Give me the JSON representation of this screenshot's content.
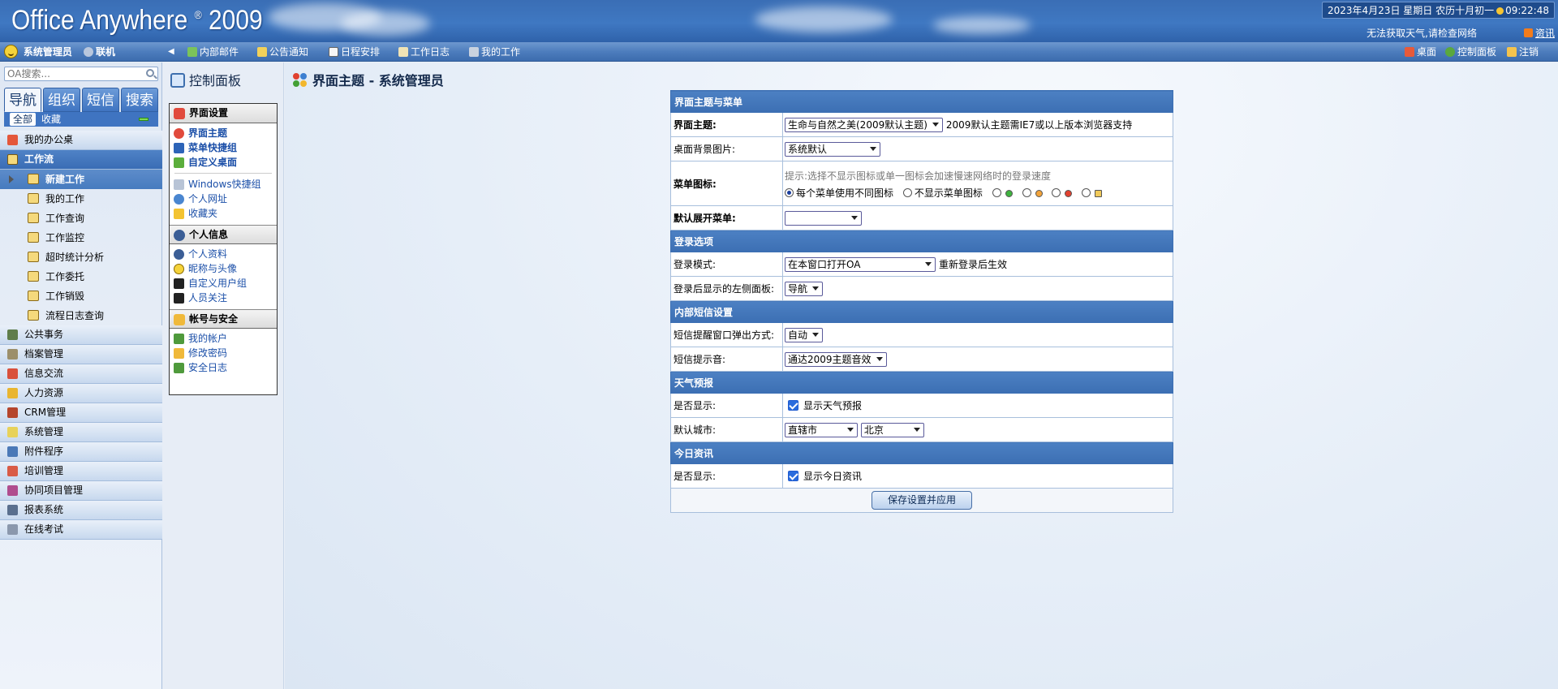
{
  "header": {
    "app_name": "Office Anywhere",
    "registered": "®",
    "version": "2009",
    "datetime": "2023年4月23日 星期日 农历十月初一",
    "time": "09:22:48",
    "weather": "无法获取天气,请检查网络",
    "news": "资讯"
  },
  "toolbar": {
    "user": "系统管理员",
    "status": "联机",
    "items": [
      "内部邮件",
      "公告通知",
      "日程安排",
      "工作日志",
      "我的工作"
    ],
    "desktop": "桌面",
    "control_panel": "控制面板",
    "logout": "注销"
  },
  "sidebar": {
    "search_placeholder": "OA搜索...",
    "tabs": [
      "导航",
      "组织",
      "短信",
      "搜索"
    ],
    "subtabs": [
      "全部",
      "收藏"
    ],
    "menu_top": "我的办公桌",
    "workflow": "工作流",
    "workflow_items": [
      "新建工作",
      "我的工作",
      "工作查询",
      "工作监控",
      "超时统计分析",
      "工作委托",
      "工作销毁",
      "流程日志查询"
    ],
    "menu_rest": [
      "公共事务",
      "档案管理",
      "信息交流",
      "人力资源",
      "CRM管理",
      "系统管理",
      "附件程序",
      "培训管理",
      "协同项目管理",
      "报表系统",
      "在线考试"
    ]
  },
  "panel": {
    "title": "控制面板",
    "sec1": "界面设置",
    "sec1_items": [
      "界面主题",
      "菜单快捷组",
      "自定义桌面"
    ],
    "sec1_extra": [
      "Windows快捷组",
      "个人网址",
      "收藏夹"
    ],
    "sec2": "个人信息",
    "sec2_items": [
      "个人资料",
      "昵称与头像",
      "自定义用户组",
      "人员关注"
    ],
    "sec3": "帐号与安全",
    "sec3_items": [
      "我的帐户",
      "修改密码",
      "安全日志"
    ]
  },
  "main": {
    "title": "界面主题 - 系统管理员",
    "sec_theme": "界面主题与菜单",
    "theme_label": "界面主题:",
    "theme_value": "生命与自然之美(2009默认主题)",
    "theme_note": "2009默认主题需IE7或以上版本浏览器支持",
    "bg_label": "桌面背景图片:",
    "bg_value": "系统默认",
    "icon_label": "菜单图标:",
    "icon_hint": "提示:选择不显示图标或单一图标会加速慢速网络时的登录速度",
    "icon_opt1": "每个菜单使用不同图标",
    "icon_opt2": "不显示菜单图标",
    "expand_label": "默认展开菜单:",
    "expand_value": "",
    "sec_login": "登录选项",
    "login_mode_label": "登录模式:",
    "login_mode_value": "在本窗口打开OA",
    "login_mode_note": "重新登录后生效",
    "login_panel_label": "登录后显示的左侧面板:",
    "login_panel_value": "导航",
    "sec_sms": "内部短信设置",
    "sms_popup_label": "短信提醒窗口弹出方式:",
    "sms_popup_value": "自动",
    "sms_sound_label": "短信提示音:",
    "sms_sound_value": "通达2009主题音效",
    "sec_weather": "天气预报",
    "weather_show_label": "是否显示:",
    "weather_show_text": "显示天气预报",
    "city_label": "默认城市:",
    "city_province": "直辖市",
    "city_name": "北京",
    "sec_news": "今日资讯",
    "news_show_label": "是否显示:",
    "news_show_text": "显示今日资讯",
    "save": "保存设置并应用"
  },
  "colors": {
    "accent": "#3c6fb3",
    "link": "#1b4fa8",
    "header": "#3a6eb5"
  }
}
